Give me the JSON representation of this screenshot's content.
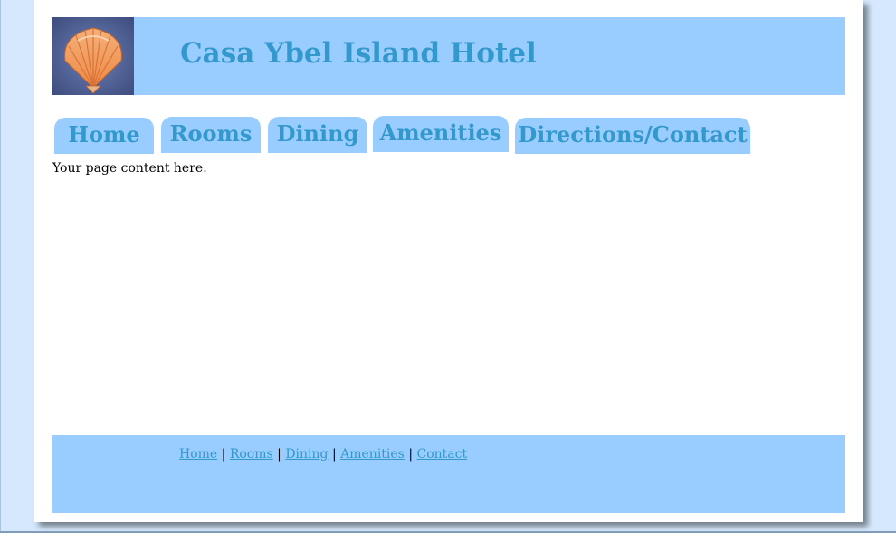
{
  "header": {
    "title": "Casa Ybel Island Hotel",
    "logo_icon": "scallop-shell-icon"
  },
  "nav": {
    "tabs": [
      {
        "label": "Home"
      },
      {
        "label": "Rooms"
      },
      {
        "label": "Dining"
      },
      {
        "label": "Amenities"
      },
      {
        "label": "Directions/Contact"
      }
    ]
  },
  "content": {
    "text": "Your page content here."
  },
  "footer": {
    "links": [
      {
        "label": "Home"
      },
      {
        "label": "Rooms"
      },
      {
        "label": "Dining"
      },
      {
        "label": "Amenities"
      },
      {
        "label": "Contact"
      }
    ],
    "separator": "|"
  },
  "colors": {
    "background": "#d5e8fd",
    "panel": "#99ccff",
    "accent_text": "#3399cc",
    "page": "#ffffff"
  }
}
